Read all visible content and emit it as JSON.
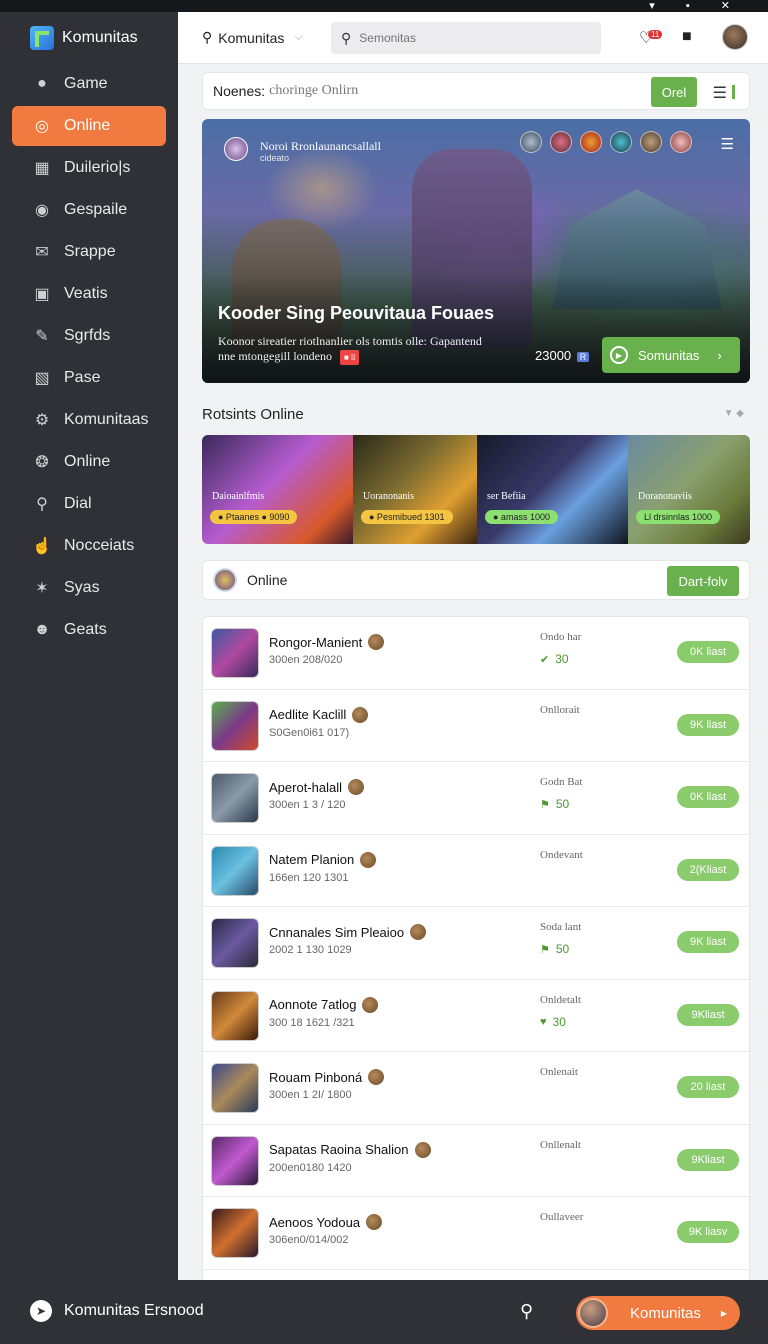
{
  "app": {
    "brand": "Komunitas"
  },
  "nav": [
    {
      "label": "Game",
      "icon": "fire-icon",
      "active": false
    },
    {
      "label": "Online",
      "icon": "globe-icon",
      "active": true
    },
    {
      "label": "Duilerio|s",
      "icon": "building-icon",
      "active": false
    },
    {
      "label": "Gespaile",
      "icon": "disc-icon",
      "active": false
    },
    {
      "label": "Srappe",
      "icon": "mail-icon",
      "active": false
    },
    {
      "label": "Veatis",
      "icon": "inbox-icon",
      "active": false
    },
    {
      "label": "Sgrfds",
      "icon": "pen-icon",
      "active": false
    },
    {
      "label": "Pase",
      "icon": "store-icon",
      "active": false
    },
    {
      "label": "Komunitaas",
      "icon": "gear-icon",
      "active": false
    },
    {
      "label": "Online",
      "icon": "dial-icon",
      "active": false
    },
    {
      "label": "Dial",
      "icon": "location-pin-icon",
      "active": false
    },
    {
      "label": "Nocceiats",
      "icon": "thumbs-up-icon",
      "active": false
    },
    {
      "label": "Syas",
      "icon": "nodes-icon",
      "active": false
    },
    {
      "label": "Geats",
      "icon": "user-icon",
      "active": false
    }
  ],
  "topbar": {
    "community_label": "Komunitas",
    "search_placeholder": "Semonitas",
    "notification_count": "11"
  },
  "filter": {
    "label": "Noenes:",
    "value": "choringe Onlirn",
    "button": "Orel"
  },
  "hero": {
    "subtitle": "Noroi Rronlaunancsallall",
    "tag": "cideato",
    "title": "Kooder Sing Peouvitaua Fouaes",
    "description_line1": "Koonor sireatier riotlnanlier ols tomtis olle: Gapantend",
    "description_line2": "nne mtongegill londeno",
    "badge": "■ ll",
    "count": "23000",
    "count_badge": "R",
    "cta": "Somunitas"
  },
  "section": {
    "title": "Rotsints Online"
  },
  "tiles": [
    {
      "label": "Daioainlfmis",
      "pill": "● Ptaanes ● 9090"
    },
    {
      "label": "Uoranonanis",
      "pill": "● Pesmibued 1301"
    },
    {
      "label": "ser Befiia",
      "pill": "● amass 1000"
    },
    {
      "label": "Doranonaviis",
      "pill": "Ll drsinnlas 1000"
    }
  ],
  "online_bar": {
    "label": "Online",
    "button": "Dart-folv"
  },
  "rows": [
    {
      "name": "Rongor-Manient",
      "meta": "300en 208/020",
      "status": "Ondo har",
      "value": "30",
      "value_icon": "✔",
      "action": "0K liast"
    },
    {
      "name": "Aedlite Kaclill",
      "meta": "S0Gen0i61 017)",
      "status": "Onllorait",
      "value": "",
      "value_icon": "",
      "action": "9K liast"
    },
    {
      "name": "Aperot-halall",
      "meta": "300en 1 3 / 120",
      "status": "Godn Bat",
      "value": "50",
      "value_icon": "⚑",
      "action": "0K liast"
    },
    {
      "name": "Natem Planion",
      "meta": "166en 120 1301",
      "status": "Ondevant",
      "value": "",
      "value_icon": "",
      "action": "2(Kliast"
    },
    {
      "name": "Cnnanales Sim Pleaioo",
      "meta": "2002 1 130 1029",
      "status": "Soda lant",
      "value": "50",
      "value_icon": "⚑",
      "action": "9K liast"
    },
    {
      "name": "Aonnote 7atlog",
      "meta": "300 18 1621 /321",
      "status": "Onldetalt",
      "value": "30",
      "value_icon": "♥",
      "action": "9Kliast"
    },
    {
      "name": "Rouam Pinboná",
      "meta": "300en 1 2I/ 1800",
      "status": "Onlenait",
      "value": "",
      "value_icon": "",
      "action": "20 liast"
    },
    {
      "name": "Sapatas Raoina Shalion",
      "meta": "200en0180 1420",
      "status": "Onllenalt",
      "value": "",
      "value_icon": "",
      "action": "9Kliast"
    },
    {
      "name": "Aenoos Yodoua",
      "meta": "306en0/014/002",
      "status": "Oullaveer",
      "value": "",
      "value_icon": "",
      "action": "9K liasv"
    },
    {
      "name": "",
      "meta": "",
      "status": "",
      "value": "",
      "value_icon": "",
      "action": ""
    }
  ],
  "bottom": {
    "label": "Komunitas Ersnood",
    "cta": "Komunitas"
  },
  "colors": {
    "accent_orange": "#f07a3f",
    "accent_green": "#69b14c",
    "sidebar_bg": "#2f3137"
  }
}
